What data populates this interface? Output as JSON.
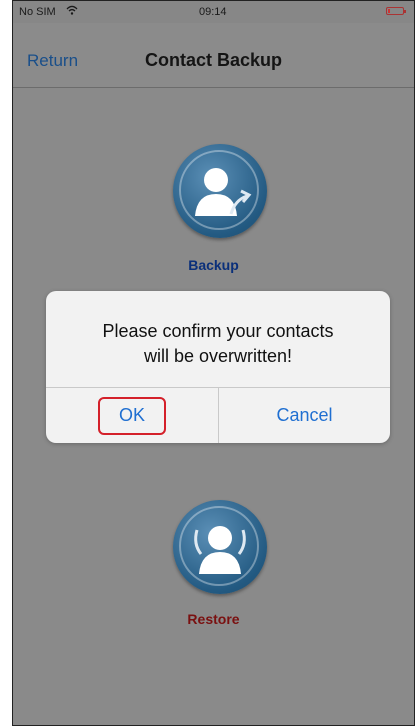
{
  "status_bar": {
    "carrier": "No SIM",
    "wifi_icon": "wifi-icon",
    "time": "09:14",
    "battery_icon": "battery-low-icon"
  },
  "nav_bar": {
    "back_label": "Return",
    "title": "Contact Backup"
  },
  "actions": {
    "backup": {
      "label": "Backup",
      "icon": "contact-backup-icon",
      "label_color": "#0a2f7a"
    },
    "restore": {
      "label": "Restore",
      "icon": "contact-restore-icon",
      "label_color": "#7a1010"
    }
  },
  "dialog": {
    "message_line1": "Please confirm your contacts",
    "message_line2": "will be overwritten!",
    "ok_label": "OK",
    "cancel_label": "Cancel",
    "button_color": "#1f6fd1",
    "highlight_color": "#d4202a"
  }
}
